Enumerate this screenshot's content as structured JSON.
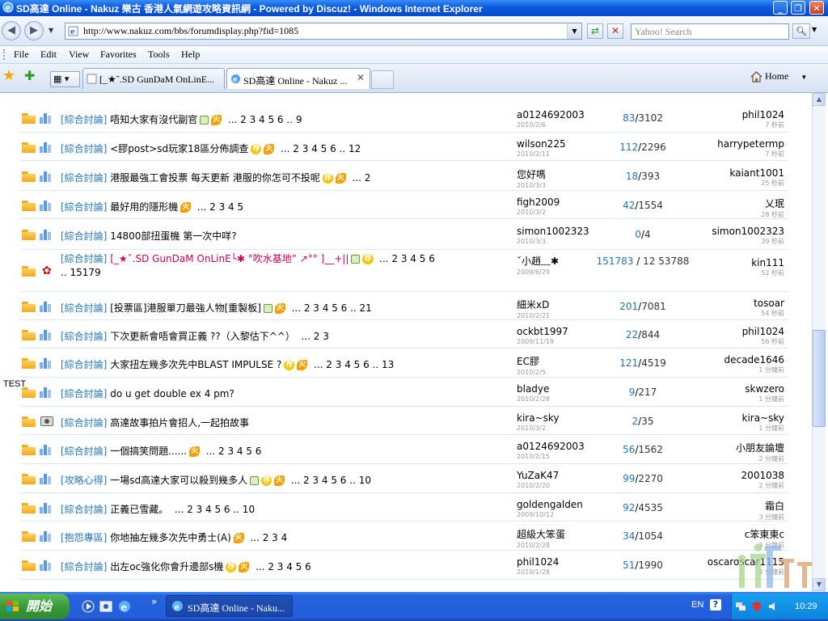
{
  "window": {
    "title": "SD高達 Online - Nakuz 樂古 香港人氣網遊攻略資訊網 - Powered by Discuz! - Windows Internet Explorer",
    "minimize": "_",
    "maximize": "❐",
    "close": "✕"
  },
  "address_bar": {
    "url": "http://www.nakuz.com/bbs/forumdisplay.php?fid=1085",
    "search_placeholder": "Yahoo! Search"
  },
  "menu": [
    "File",
    "Edit",
    "View",
    "Favorites",
    "Tools",
    "Help"
  ],
  "tabs": [
    {
      "label": "[_★ˇ.SD GunDaM OnLinE..."
    },
    {
      "label": "SD高達 Online - Nakuz ...",
      "close": "✕"
    }
  ],
  "home_label": "Home",
  "overlay_text": "TEST",
  "threads": [
    {
      "category": "[綜合討論]",
      "title": "唔知大家有沒代副官",
      "badges": [
        "img",
        "hot"
      ],
      "pages": "... 2 3 4 5 6 .. 9",
      "author": "a0124692003",
      "date": "2010/2/6",
      "replies": "83",
      "views": "3102",
      "last_user": "phil1024",
      "last_time": "7 秒前",
      "icon": "bars"
    },
    {
      "category": "[綜合討論]",
      "title": "<膠post>sd玩家18區分佈調查",
      "badges": [
        "rec",
        "hot"
      ],
      "pages": "... 2 3 4 5 6 .. 12",
      "author": "wilson225",
      "date": "2010/2/11",
      "replies": "112",
      "views": "2296",
      "last_user": "harrypetermp",
      "last_time": "7 秒前",
      "icon": "bars"
    },
    {
      "category": "[綜合討論]",
      "title": "港服最強工會投票 每天更新 港服的你怎可不投呢",
      "badges": [
        "rec",
        "hot"
      ],
      "pages": "... 2",
      "author": "您好嗎",
      "date": "2010/3/3",
      "replies": "18",
      "views": "393",
      "last_user": "kaiant1001",
      "last_time": "25 秒前",
      "icon": "bars"
    },
    {
      "category": "[綜合討論]",
      "title": "最好用的隱形機",
      "badges": [
        "hot"
      ],
      "pages": "... 2 3 4 5",
      "author": "figh2009",
      "date": "2010/3/2",
      "replies": "42",
      "views": "1554",
      "last_user": "乂珉",
      "last_time": "28 秒前",
      "icon": "bars"
    },
    {
      "category": "[綜合討論]",
      "title": "14800部扭蛋機 第一次中咩?",
      "badges": [],
      "pages": "",
      "author": "simon1002323",
      "date": "2010/3/3",
      "replies": "0",
      "views": "4",
      "last_user": "simon1002323",
      "last_time": "39 秒前",
      "icon": "bars"
    },
    {
      "category": "[綜合討論]",
      "title": "[_★ˇ.SD GunDaM OnLinE└✱ °吹水基地” ↗°° ]__+||",
      "badges": [
        "img",
        "rec"
      ],
      "pages": "... 2 3 4 5 6 .. 15179",
      "author": "ˇ小趙﹏✱",
      "date": "2009/6/29",
      "replies": "151783",
      "views": "12 53788",
      "last_user": "kin111",
      "last_time": "52 秒前",
      "icon": "rose"
    },
    {
      "category": "[綜合討論]",
      "title": "[投票區]港服單刀最強人物[重製板]",
      "badges": [
        "img",
        "hot"
      ],
      "pages": "... 2 3 4 5 6 .. 21",
      "author": "細米xD",
      "date": "2010/2/21",
      "replies": "201",
      "views": "7081",
      "last_user": "tosoar",
      "last_time": "54 秒前",
      "icon": "bars"
    },
    {
      "category": "[綜合討論]",
      "title": "下次更新會唔會買正義 ??（入黎估下^^）",
      "badges": [],
      "pages": "... 2 3",
      "author": "ockbt1997",
      "date": "2009/11/19",
      "replies": "22",
      "views": "844",
      "last_user": "phil1024",
      "last_time": "56 秒前",
      "icon": "bars"
    },
    {
      "category": "[綜合討論]",
      "title": "大家扭左幾多次先中BLAST IMPULSE ?",
      "badges": [
        "rec",
        "hot"
      ],
      "pages": "... 2 3 4 5 6 .. 13",
      "author": "EC膠",
      "date": "2010/2/5",
      "replies": "121",
      "views": "4519",
      "last_user": "decade1646",
      "last_time": "1 分鐘前",
      "icon": "bars"
    },
    {
      "category": "[綜合討論]",
      "title": "do u get double ex 4 pm?",
      "badges": [],
      "pages": "",
      "author": "bladye",
      "date": "2010/2/28",
      "replies": "9",
      "views": "217",
      "last_user": "skwzero",
      "last_time": "1 分鐘前",
      "icon": "bars"
    },
    {
      "category": "[綜合討論]",
      "title": "高達故事拍片會招人,一起拍故事",
      "badges": [],
      "pages": "",
      "author": "kira~sky",
      "date": "2010/3/2",
      "replies": "2",
      "views": "35",
      "last_user": "kira~sky",
      "last_time": "1 分鐘前",
      "icon": "camera"
    },
    {
      "category": "[綜合討論]",
      "title": "一個搞笑問題......",
      "badges": [
        "hot"
      ],
      "pages": "... 2 3 4 5 6",
      "author": "a0124692003",
      "date": "2010/2/15",
      "replies": "56",
      "views": "1562",
      "last_user": "小朋友論壇",
      "last_time": "2 分鐘前",
      "icon": "bars"
    },
    {
      "category": "[攻略心得]",
      "title": "一場sd高達大家可以殺到幾多人",
      "badges": [
        "img",
        "rec",
        "hot"
      ],
      "pages": "... 2 3 4 5 6 .. 10",
      "author": "YuZaK47",
      "date": "2010/2/20",
      "replies": "99",
      "views": "2270",
      "last_user": "2001038",
      "last_time": "2 分鐘前",
      "icon": "bars"
    },
    {
      "category": "[綜合討論]",
      "title": "正義已雪藏。",
      "badges": [],
      "pages": "... 2 3 4 5 6 .. 10",
      "author": "goldengalden",
      "date": "2009/10/12",
      "replies": "92",
      "views": "4535",
      "last_user": "霜白",
      "last_time": "3 分鐘前",
      "icon": "bars"
    },
    {
      "category": "[抱怨專區]",
      "title": "你地抽左幾多次先中勇士(A)",
      "badges": [
        "hot"
      ],
      "pages": "... 2 3 4",
      "author": "超級大笨蛋",
      "date": "2010/2/28",
      "replies": "34",
      "views": "1054",
      "last_user": "c笨東東c",
      "last_time": "3 分鐘前",
      "icon": "bars"
    },
    {
      "category": "[綜合討論]",
      "title": "出左oc強化你會升邊部s機",
      "badges": [
        "rec",
        "hot"
      ],
      "pages": "... 2 3 4 5 6",
      "author": "phil1024",
      "date": "2010/1/28",
      "replies": "51",
      "views": "1990",
      "last_user": "oscaroscar1115",
      "last_time": "3 分鐘前",
      "icon": "bars"
    }
  ],
  "taskbar": {
    "start": "開始",
    "task_button": "SD高達 Online - Naku...",
    "lang": "EN",
    "help": "?",
    "clock": "10:29",
    "more": "»"
  },
  "colors": {
    "category_link": "#2474b5",
    "folder": "#f4a820",
    "titlebar": "#0a5ae0",
    "taskbar": "#245edb",
    "start": "#3a9a3a"
  },
  "icons": {
    "folder": "folder-icon",
    "stats": "bar-chart-icon",
    "rose": "rose-icon",
    "camera": "camera-icon"
  }
}
